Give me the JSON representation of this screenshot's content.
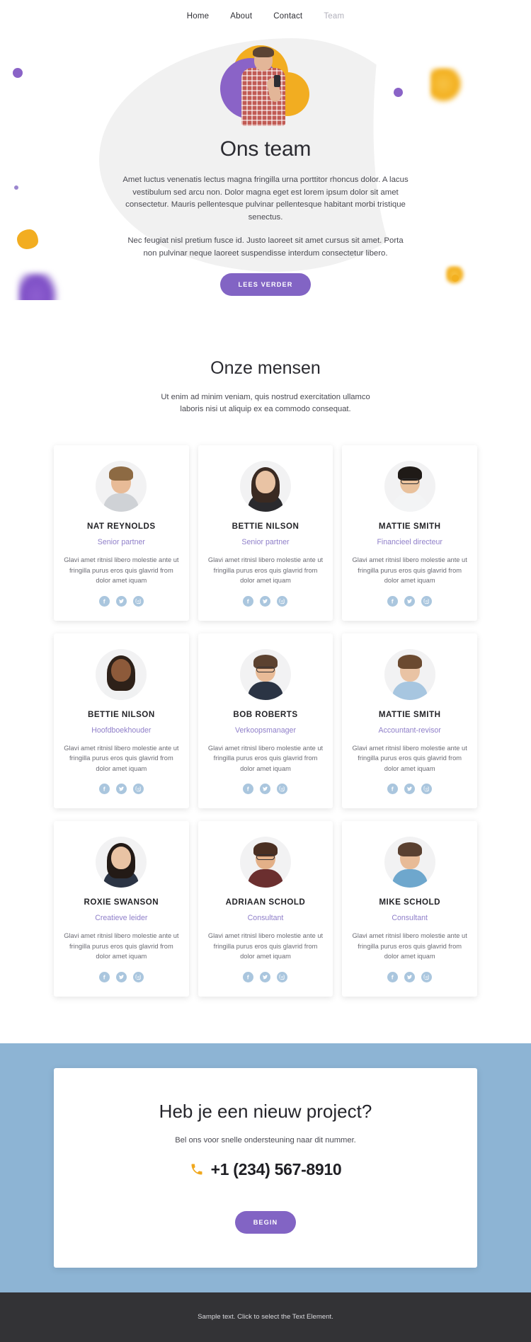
{
  "nav": {
    "items": [
      {
        "label": "Home",
        "active": false
      },
      {
        "label": "About",
        "active": false
      },
      {
        "label": "Contact",
        "active": false
      },
      {
        "label": "Team",
        "active": true
      }
    ]
  },
  "hero": {
    "title": "Ons team",
    "paragraph1": "Amet luctus venenatis lectus magna fringilla urna porttitor rhoncus dolor. A lacus vestibulum sed arcu non. Dolor magna eget est lorem ipsum dolor sit amet consectetur. Mauris pellentesque pulvinar pellentesque habitant morbi tristique senectus.",
    "paragraph2": "Nec feugiat nisl pretium fusce id. Justo laoreet sit amet cursus sit amet. Porta non pulvinar neque laoreet suspendisse interdum consectetur libero.",
    "button_label": "LEES VERDER"
  },
  "team_section": {
    "title": "Onze mensen",
    "subtitle": "Ut enim ad minim veniam, quis nostrud exercitation ullamco laboris nisi ut aliquip ex ea commodo consequat.",
    "card_description": "Glavi amet ritnisl libero molestie ante ut fringilla purus eros quis glavrid from dolor amet iquam",
    "members": [
      {
        "name": "NAT REYNOLDS",
        "role": "Senior partner"
      },
      {
        "name": "BETTIE NILSON",
        "role": "Senior partner"
      },
      {
        "name": "MATTIE SMITH",
        "role": "Financieel directeur"
      },
      {
        "name": "BETTIE NILSON",
        "role": "Hoofdboekhouder"
      },
      {
        "name": "BOB ROBERTS",
        "role": "Verkoopsmanager"
      },
      {
        "name": "MATTIE SMITH",
        "role": "Accountant-revisor"
      },
      {
        "name": "ROXIE SWANSON",
        "role": "Creatieve leider"
      },
      {
        "name": "ADRIAAN SCHOLD",
        "role": "Consultant"
      },
      {
        "name": "MIKE SCHOLD",
        "role": "Consultant"
      }
    ],
    "social_icons": [
      "facebook-icon",
      "twitter-icon",
      "instagram-icon"
    ]
  },
  "cta": {
    "title": "Heb je een nieuw project?",
    "subtitle": "Bel ons voor snelle ondersteuning naar dit nummer.",
    "phone": "+1 (234) 567-8910",
    "phone_icon": "phone-icon",
    "button_label": "BEGIN"
  },
  "footer": {
    "text": "Sample text. Click to select the Text Element."
  },
  "colors": {
    "purple": "#8264c4",
    "role_purple": "#8f7fc9",
    "blue_band": "#8db4d4",
    "social_blue": "#aac6de",
    "orange": "#f0a81e",
    "footer_dark": "#333336"
  }
}
